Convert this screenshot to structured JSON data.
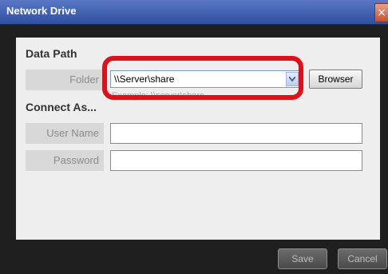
{
  "window": {
    "title": "Network Drive",
    "close_glyph": "×"
  },
  "data_path": {
    "section_title": "Data Path",
    "folder_label": "Folder",
    "folder_value": "\\\\Server\\share",
    "hint": "Example: \\\\server\\share",
    "browser_button": "Browser"
  },
  "connect_as": {
    "section_title": "Connect As...",
    "user_name_label": "User Name",
    "user_name_value": "",
    "password_label": "Password",
    "password_value": ""
  },
  "footer": {
    "save_button": "Save",
    "cancel_button": "Cancel"
  },
  "colors": {
    "highlight": "#e0101b",
    "titlebar": "#3a5aad",
    "window_bg": "#1f1f1f",
    "panel_bg": "#eeeeee"
  },
  "icons": {
    "close": "close-icon",
    "dropdown": "chevron-down-icon"
  }
}
